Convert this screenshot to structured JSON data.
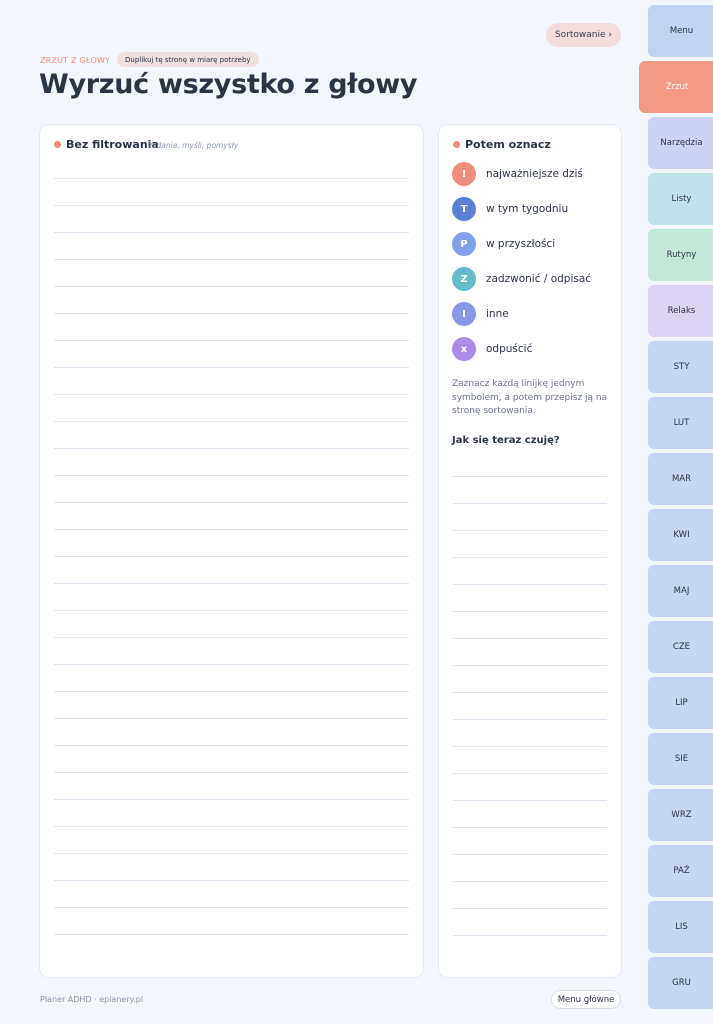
{
  "header": {
    "sort_button": "Sortowanie ›",
    "eyebrow": "ZRZUT Z GŁOWY",
    "pill": "Duplikuj tę stronę w miarę potrzeby",
    "title": "Wyrzuć wszystko z głowy"
  },
  "left_card": {
    "title": "Bez filtrowania",
    "subtitle": "zadania, myśli, pomysły",
    "line_count": 29
  },
  "right_card": {
    "title": "Potem oznacz",
    "legend": [
      {
        "symbol": "!",
        "label": "najważniejsze dziś",
        "color": "#ef8d7c"
      },
      {
        "symbol": "T",
        "label": "w tym tygodniu",
        "color": "#5b7fd6"
      },
      {
        "symbol": "P",
        "label": "w przyszłości",
        "color": "#7ea3ec"
      },
      {
        "symbol": "Z",
        "label": "zadzwonić / odpisać",
        "color": "#65bccd"
      },
      {
        "symbol": "I",
        "label": "inne",
        "color": "#8a96e8"
      },
      {
        "symbol": "x",
        "label": "odpuścić",
        "color": "#ab8ce8"
      }
    ],
    "note": "Zaznacz każdą linijkę jednym symbolem, a potem przepisz ją na stronę sortowania.",
    "feel_heading": "Jak się teraz czuję?",
    "feel_line_count": 18
  },
  "footer": {
    "brand": "Planer ADHD · eplanery.pl",
    "menu_button": "Menu główne"
  },
  "tabs": [
    {
      "label": "Menu",
      "color": "#c3d1f2",
      "active": false
    },
    {
      "label": "Zrzut",
      "color": "#f29a84",
      "active": true
    },
    {
      "label": "Narzędzia",
      "color": "#cdd3f6",
      "active": false
    },
    {
      "label": "Listy",
      "color": "#bfe2ec",
      "active": false
    },
    {
      "label": "Rutyny",
      "color": "#c4e8d8",
      "active": false
    },
    {
      "label": "Relaks",
      "color": "#ddd3f5",
      "active": false
    },
    {
      "label": "STY",
      "color": "#c8d6f5",
      "active": false
    },
    {
      "label": "LUT",
      "color": "#c8d6f5",
      "active": false
    },
    {
      "label": "MAR",
      "color": "#c8d6f5",
      "active": false
    },
    {
      "label": "KWI",
      "color": "#c8d6f5",
      "active": false
    },
    {
      "label": "MAJ",
      "color": "#c8d6f5",
      "active": false
    },
    {
      "label": "CZE",
      "color": "#c8d6f5",
      "active": false
    },
    {
      "label": "LIP",
      "color": "#c8d6f5",
      "active": false
    },
    {
      "label": "SIE",
      "color": "#c8d6f5",
      "active": false
    },
    {
      "label": "WRZ",
      "color": "#c8d6f5",
      "active": false
    },
    {
      "label": "PAŹ",
      "color": "#c8d6f5",
      "active": false
    },
    {
      "label": "LIS",
      "color": "#c8d6f5",
      "active": false
    },
    {
      "label": "GRU",
      "color": "#c8d6f5",
      "active": false
    }
  ]
}
